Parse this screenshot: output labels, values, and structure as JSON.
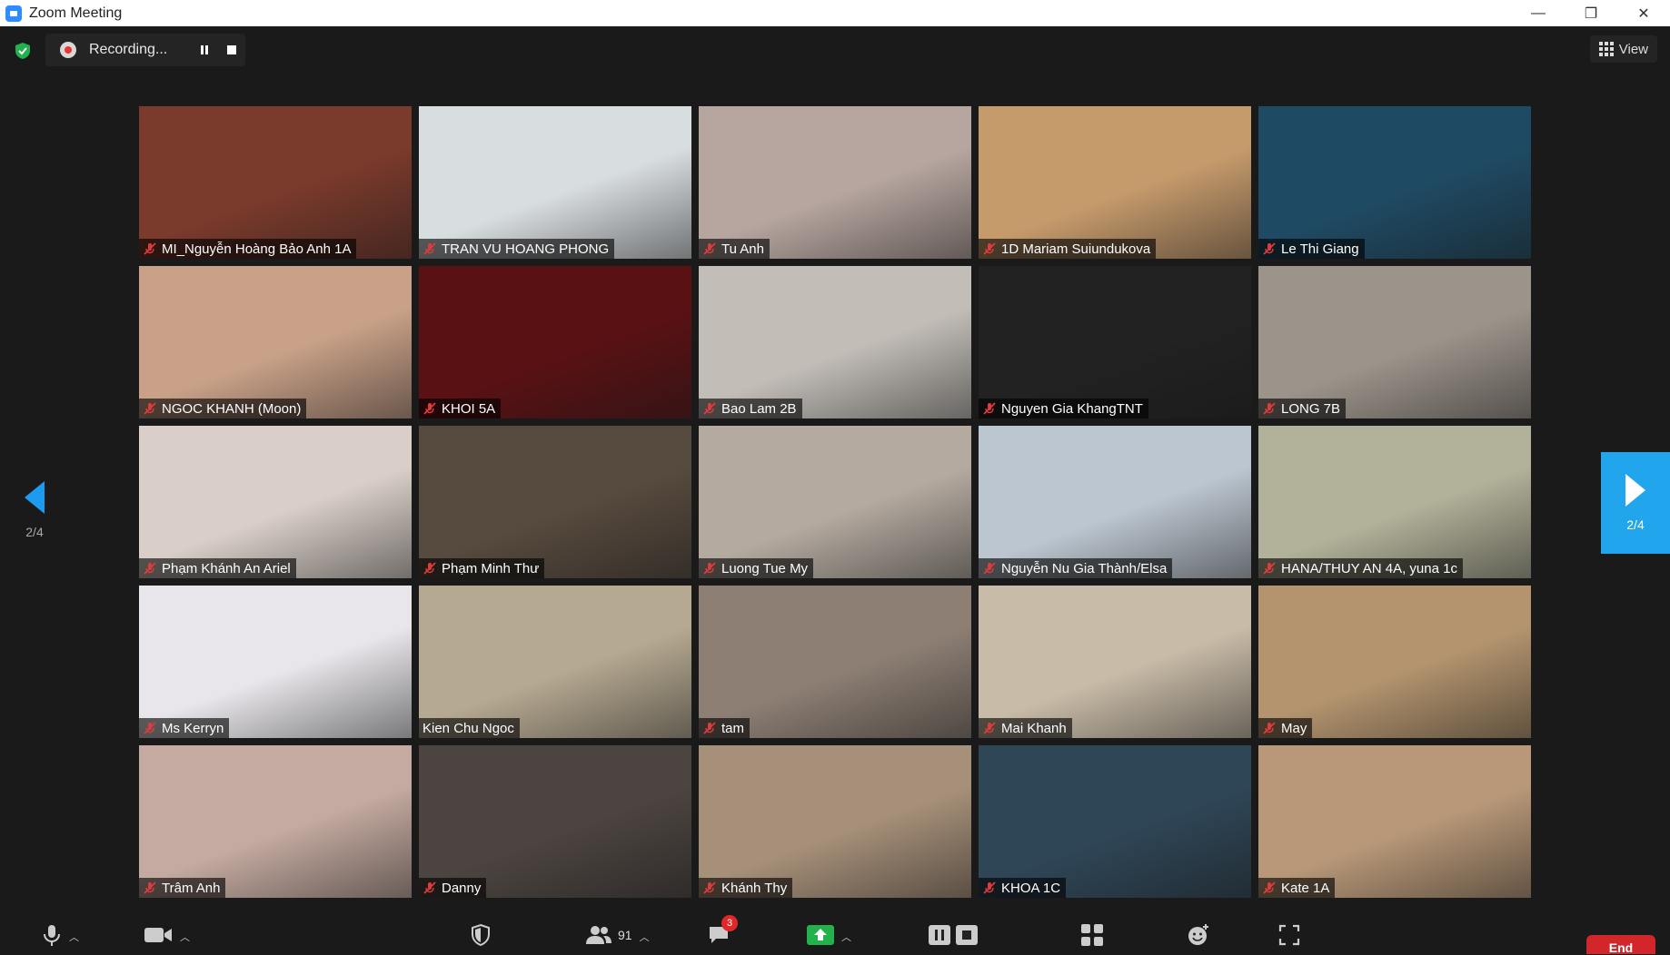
{
  "window": {
    "title": "Zoom Meeting",
    "minimize": "—",
    "restore": "❐",
    "close": "✕"
  },
  "recording": {
    "label": "Recording..."
  },
  "view": {
    "label": "View"
  },
  "navigation": {
    "prev_page": "2/4",
    "next_page": "2/4"
  },
  "participants": [
    {
      "name": "MI_Nguyễn Hoàng Bảo Anh 1A",
      "muted": true,
      "bg": "#7a3a2c"
    },
    {
      "name": "TRAN VU HOANG PHONG",
      "muted": true,
      "bg": "#d8dde0"
    },
    {
      "name": "Tu Anh",
      "muted": true,
      "bg": "#b7a6a0"
    },
    {
      "name": "1D Mariam Suiundukova",
      "muted": true,
      "bg": "#c69b6c"
    },
    {
      "name": "Le Thi Giang",
      "muted": true,
      "bg": "#1f4a63"
    },
    {
      "name": "NGOC KHANH (Moon)",
      "muted": true,
      "bg": "#c9a188"
    },
    {
      "name": "KHOI 5A",
      "muted": true,
      "bg": "#5a1114"
    },
    {
      "name": "Bao Lam 2B",
      "muted": true,
      "bg": "#c2bdb7"
    },
    {
      "name": "Nguyen Gia KhangTNT",
      "muted": true,
      "bg": "#222222"
    },
    {
      "name": "LONG 7B",
      "muted": true,
      "bg": "#9c948b"
    },
    {
      "name": "Phạm Khánh An Ariel",
      "muted": true,
      "bg": "#d9cfc8"
    },
    {
      "name": "Phạm Minh Thư",
      "muted": true,
      "bg": "#574a3e"
    },
    {
      "name": "Luong Tue My",
      "muted": true,
      "bg": "#b4aaa0"
    },
    {
      "name": "Nguyễn Nu Gia Thành/Elsa",
      "muted": true,
      "bg": "#bcc6d0"
    },
    {
      "name": "HANA/THUY AN 4A, yuna 1c",
      "muted": true,
      "bg": "#b2b199"
    },
    {
      "name": "Ms Kerryn",
      "muted": true,
      "bg": "#e8e6ea"
    },
    {
      "name": "Kien Chu Ngoc",
      "muted": false,
      "bg": "#b6a991"
    },
    {
      "name": "tam",
      "muted": true,
      "bg": "#8d7f74"
    },
    {
      "name": "Mai Khanh",
      "muted": true,
      "bg": "#c8bba7"
    },
    {
      "name": "May",
      "muted": true,
      "bg": "#b3946e"
    },
    {
      "name": "Trâm Anh",
      "muted": true,
      "bg": "#c4aaa0"
    },
    {
      "name": "Danny",
      "muted": true,
      "bg": "#4c4440"
    },
    {
      "name": "Khánh Thy",
      "muted": true,
      "bg": "#a79079"
    },
    {
      "name": "KHOA 1C",
      "muted": true,
      "bg": "#2f4657"
    },
    {
      "name": "Kate 1A",
      "muted": true,
      "bg": "#b89878"
    }
  ],
  "toolbar": {
    "participants_count": "91",
    "chat_badge": "3",
    "end_label": "End"
  },
  "colors": {
    "accent": "#21a6ee",
    "end": "#d2262b",
    "share": "#22b14c",
    "mute": "#e03b3b"
  }
}
